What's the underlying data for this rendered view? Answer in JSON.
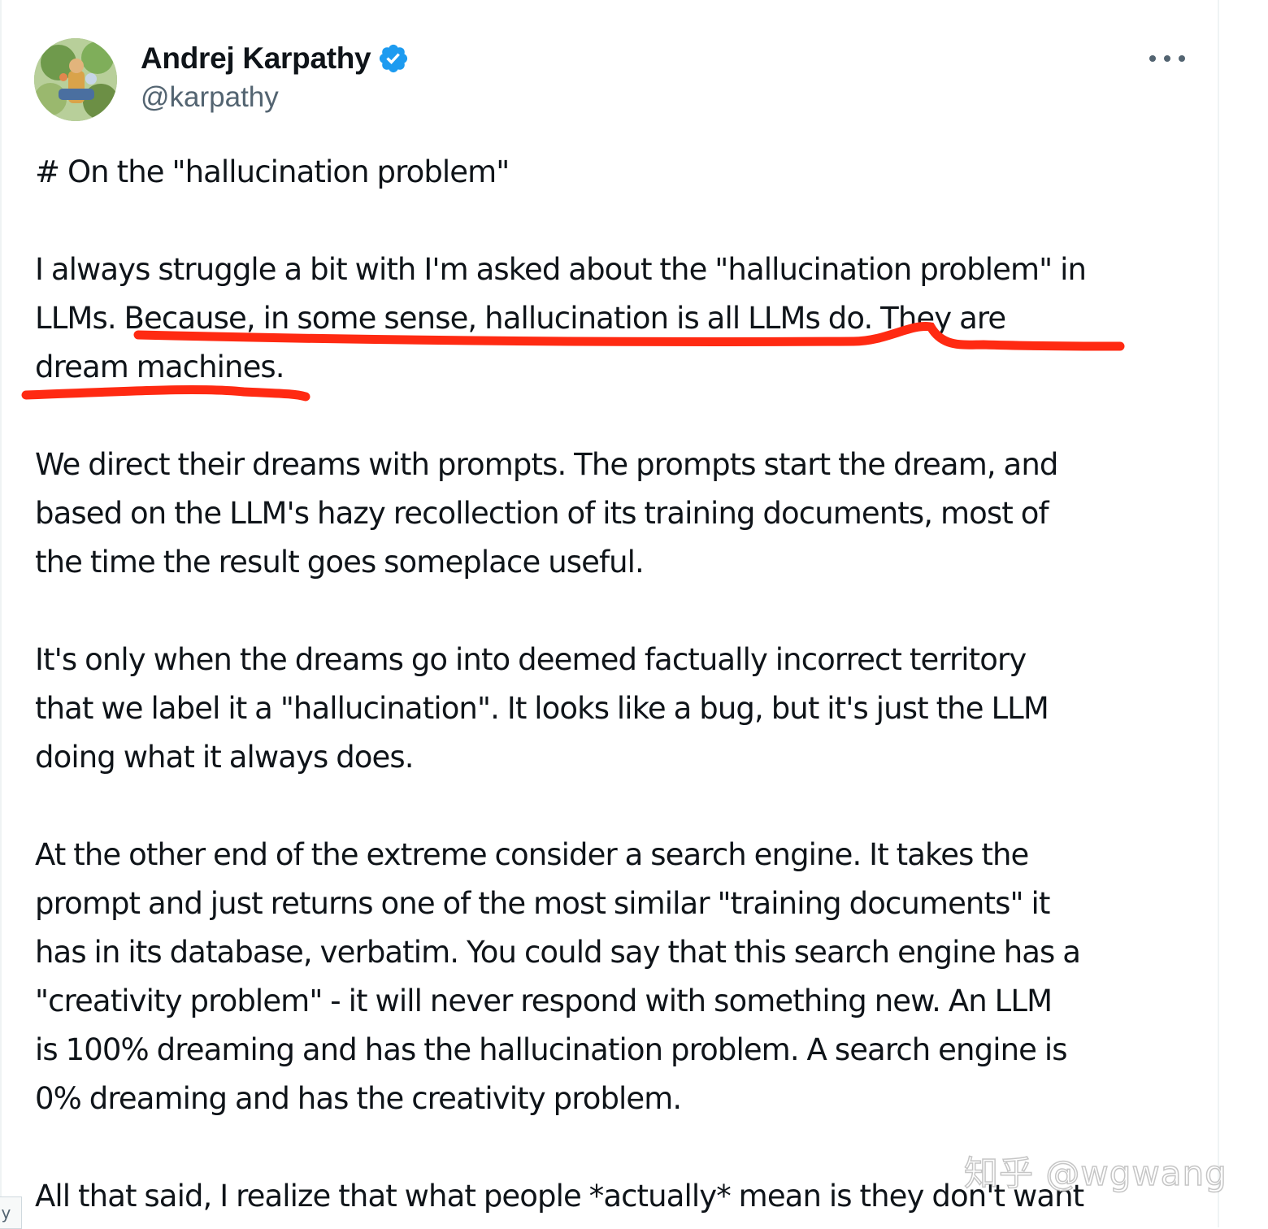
{
  "tweet": {
    "author": {
      "display_name": "Andrej Karpathy",
      "handle": "@karpathy",
      "verified": true
    },
    "more_icon": "more-horizontal-icon",
    "verified_icon": "verified-badge-icon",
    "accent_color": "#1d9bf0",
    "highlight_color": "#ff2a12",
    "paragraphs": [
      "# On the \"hallucination problem\"",
      "I always struggle a bit with I'm asked about the \"hallucination problem\" in\nLLMs. Because, in some sense, hallucination is all LLMs do. They are\ndream machines.",
      "We direct their dreams with prompts. The prompts start the dream, and\nbased on the LLM's hazy recollection of its training documents, most of\nthe time the result goes someplace useful.",
      "It's only when the dreams go into deemed factually incorrect territory\nthat we label it a \"hallucination\". It looks like a bug, but it's just the LLM\ndoing what it always does.",
      "At the other end of the extreme consider a search engine. It takes the\nprompt and just returns one of the most similar \"training documents\" it\nhas in its database, verbatim. You could say that this search engine has a\n\"creativity problem\" - it will never respond with something new. An LLM\nis 100% dreaming and has the hallucination problem. A search engine is\n0% dreaming and has the creativity problem.",
      "All that said, I realize that what people *actually* mean is they don't want"
    ]
  },
  "watermark": "知乎 @wgwang",
  "edge_tab_text": "ıy"
}
